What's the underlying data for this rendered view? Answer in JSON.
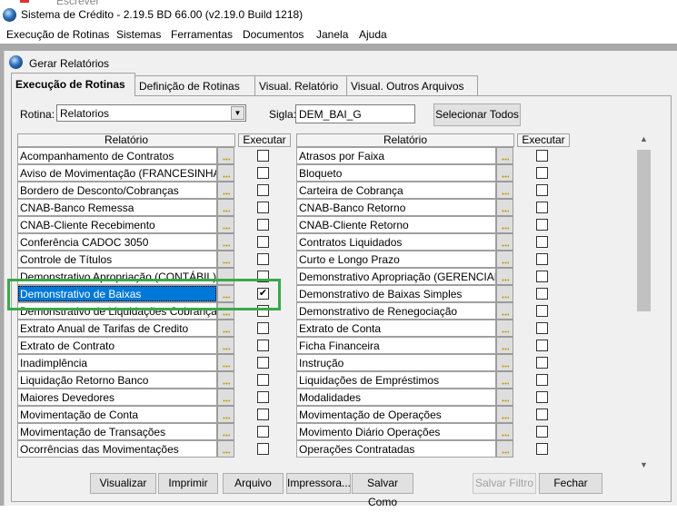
{
  "app": {
    "title": "Sistema de Crédito - 2.19.5 BD 66.00 (v2.19.0 Build 1218)",
    "behind_text": "Escrever"
  },
  "menu": [
    "Execução de Rotinas",
    "Sistemas",
    "Ferramentas",
    "Documentos",
    "Janela",
    "Ajuda"
  ],
  "window": {
    "title": "Gerar Relatórios"
  },
  "tabs": [
    "Execução de Rotinas",
    "Definição de Rotinas",
    "Visual. Relatório",
    "Visual. Outros Arquivos"
  ],
  "form": {
    "rotina_label": "Rotina:",
    "rotina_value": "Relatorios",
    "sigla_label": "Sigla:",
    "sigla_value": "DEM_BAI_G",
    "select_all": "Selecionar Todos"
  },
  "grid": {
    "col_relatorio": "Relatório",
    "col_executar": "Executar",
    "left": [
      "Acompanhamento de Contratos",
      "Aviso de Movimentação (FRANCESINHA)",
      "Bordero de Desconto/Cobranças",
      "CNAB-Banco Remessa",
      "CNAB-Cliente Recebimento",
      "Conferência CADOC 3050",
      "Controle de Títulos",
      "Demonstrativo Apropriação (CONTÁBIL)",
      "Demonstrativo de Baixas",
      "Demonstrativo de Liquidações Cobrança x Re",
      "Extrato Anual de Tarifas de Credito",
      "Extrato de Contrato",
      "Inadimplência",
      "Liquidação Retorno Banco",
      "Maiores Devedores",
      "Movimentação de Conta",
      "Movimentação de Transações",
      "Ocorrências das Movimentações"
    ],
    "left_checked_index": 8,
    "right": [
      "Atrasos por Faixa",
      "Bloqueto",
      "Carteira de Cobrança",
      "CNAB-Banco Retorno",
      "CNAB-Cliente Retorno",
      "Contratos Liquidados",
      "Curto e Longo Prazo",
      "Demonstrativo Apropriação (GERENCIAL)",
      "Demonstrativo de Baixas Simples",
      "Demonstrativo de Renegociação",
      "Extrato de Conta",
      "Ficha Financeira",
      "Instrução",
      "Liquidações de Empréstimos",
      "Modalidades",
      "Movimentação de Operações",
      "Movimento Diário Operações",
      "Operações Contratadas"
    ]
  },
  "buttons": [
    "Visualizar",
    "Imprimir",
    "Arquivo",
    "Impressora...",
    "Salvar Como",
    "Salvar Filtro",
    "Fechar"
  ],
  "check_mark": "✔",
  "icons": {
    "scroll_up": "▲",
    "scroll_down": "▼",
    "combo_arrow": "▼"
  },
  "colors": {
    "selection": "#0078d7",
    "highlight_box": "#3aa84a"
  }
}
